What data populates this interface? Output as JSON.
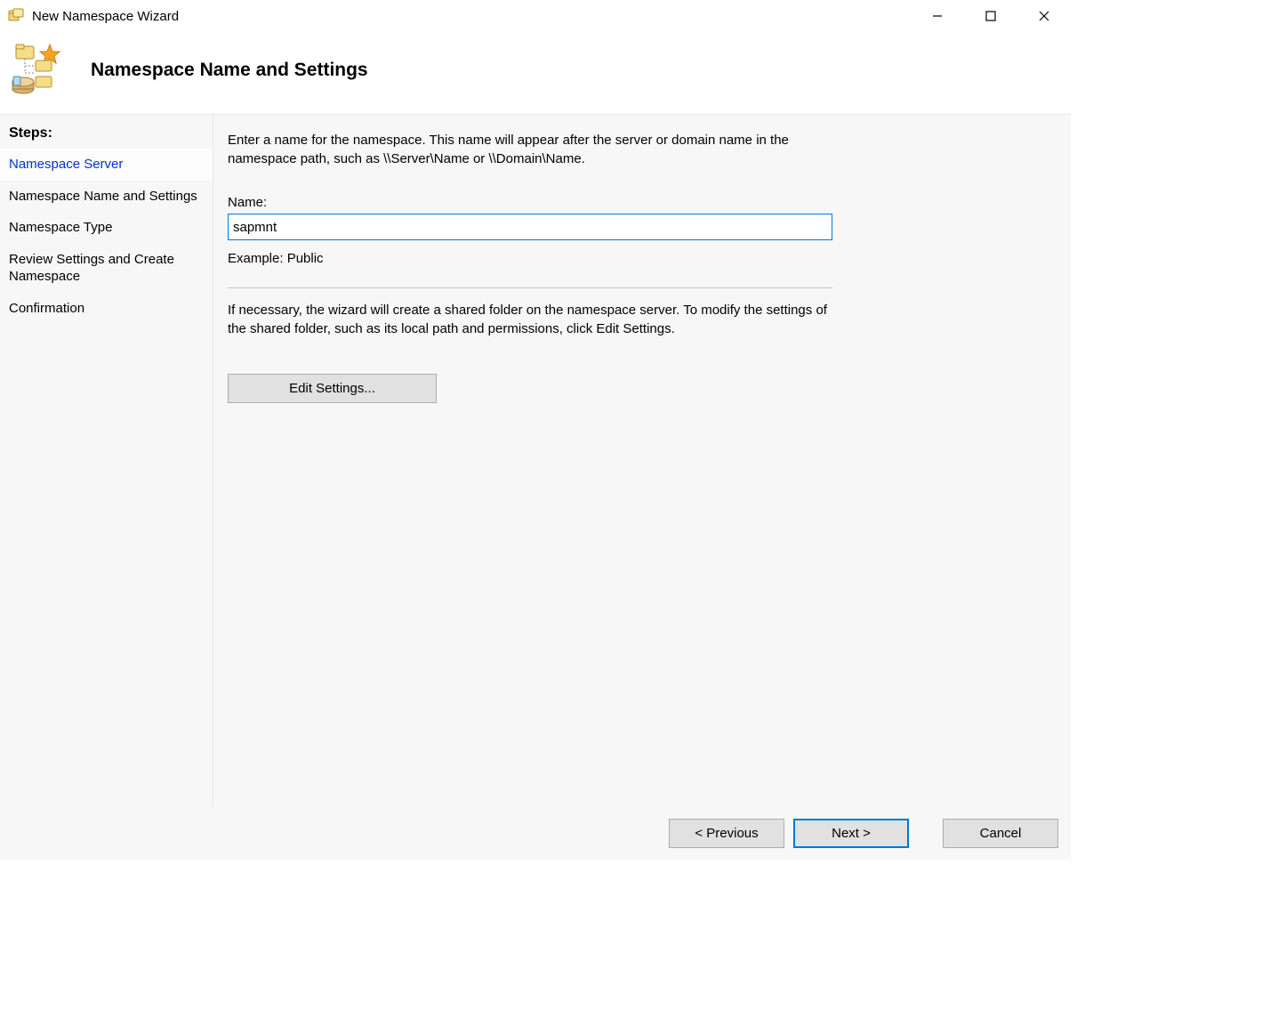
{
  "window": {
    "title": "New Namespace Wizard"
  },
  "header": {
    "page_title": "Namespace Name and Settings"
  },
  "sidebar": {
    "steps_label": "Steps:",
    "items": [
      {
        "label": "Namespace Server"
      },
      {
        "label": "Namespace Name and Settings"
      },
      {
        "label": "Namespace Type"
      },
      {
        "label": "Review Settings and Create Namespace"
      },
      {
        "label": "Confirmation"
      }
    ]
  },
  "main": {
    "intro": "Enter a name for the namespace. This name will appear after the server or domain name in the namespace path, such as \\\\Server\\Name or \\\\Domain\\Name.",
    "name_label": "Name:",
    "name_value": "sapmnt",
    "example": "Example: Public",
    "secondary": "If necessary, the wizard will create a shared folder on the namespace server. To modify the settings of the shared folder, such as its local path and permissions, click Edit Settings.",
    "edit_settings_label": "Edit Settings..."
  },
  "footer": {
    "previous_label": "< Previous",
    "next_label": "Next >",
    "cancel_label": "Cancel"
  }
}
